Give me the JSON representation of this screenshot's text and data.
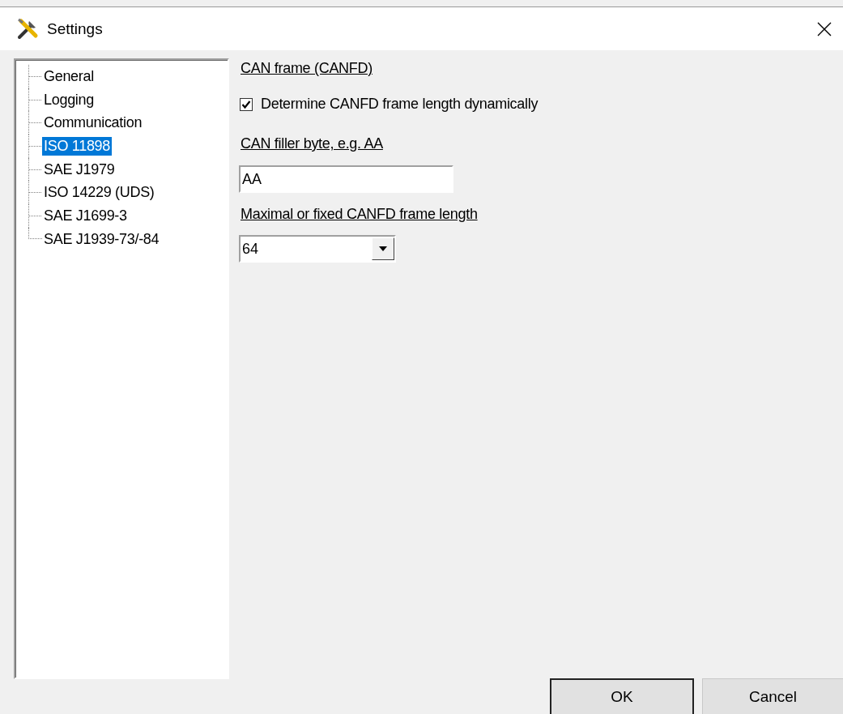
{
  "window": {
    "title": "Settings"
  },
  "tree": {
    "items": [
      {
        "label": "General",
        "selected": false
      },
      {
        "label": "Logging",
        "selected": false
      },
      {
        "label": "Communication",
        "selected": false
      },
      {
        "label": "ISO 11898",
        "selected": true
      },
      {
        "label": "SAE J1979",
        "selected": false
      },
      {
        "label": "ISO 14229 (UDS)",
        "selected": false
      },
      {
        "label": "SAE J1699-3",
        "selected": false
      },
      {
        "label": "SAE J1939-73/-84",
        "selected": false
      }
    ]
  },
  "content": [
    {
      "kind": "heading",
      "label": "CAN frame (CANFD)"
    },
    {
      "kind": "checkbox",
      "label": "Determine CANFD frame length dynamically",
      "checked": true
    },
    {
      "kind": "heading",
      "label": "CAN filler byte, e.g. AA"
    },
    {
      "kind": "textfield",
      "value": "AA"
    },
    {
      "kind": "heading",
      "label": "Maximal or fixed CANFD frame length"
    },
    {
      "kind": "dropdown",
      "value": "64"
    }
  ],
  "buttons": [
    {
      "label": "OK",
      "default": true
    },
    {
      "label": "Cancel",
      "default": false
    }
  ]
}
